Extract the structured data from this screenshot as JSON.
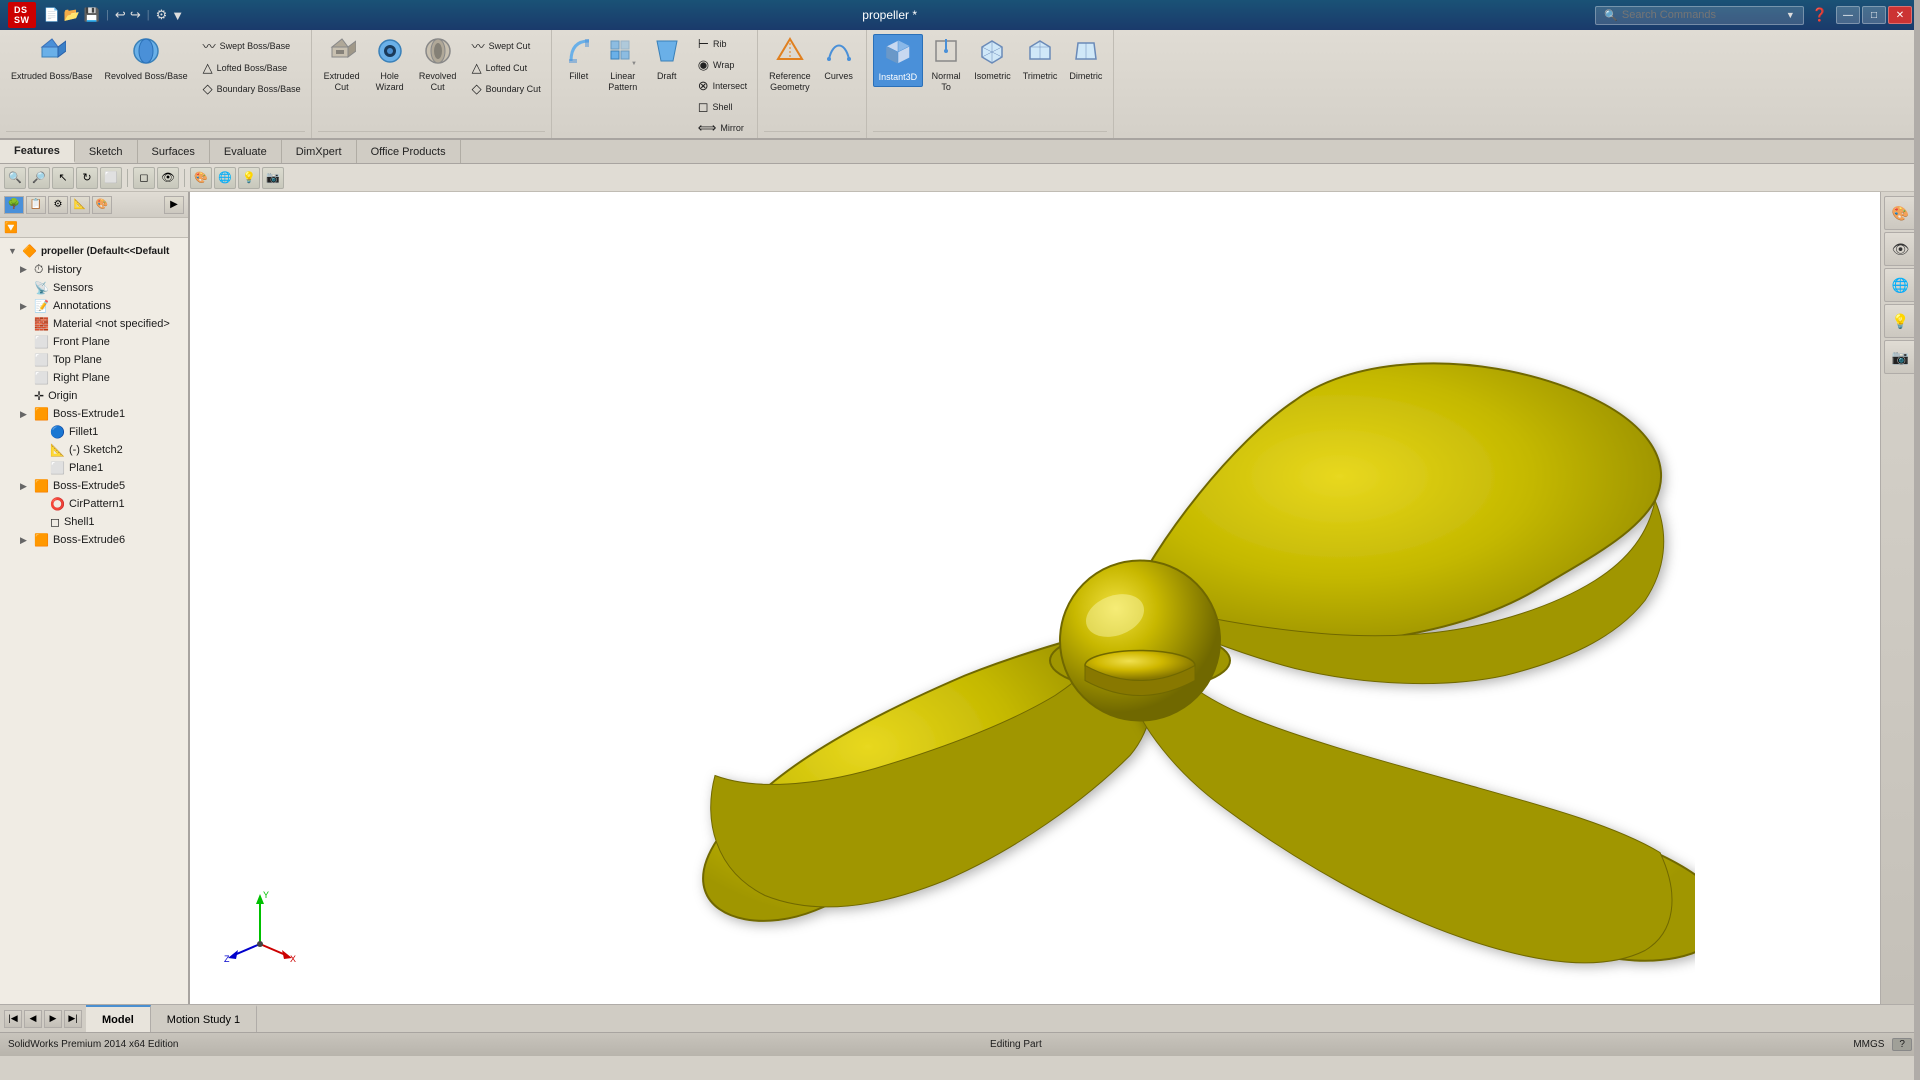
{
  "app": {
    "title": "propeller *",
    "software": "SOLIDWORKS",
    "logo_text": "DS SOLIDWORKS"
  },
  "titlebar": {
    "title": "propeller *",
    "win_controls": [
      "—",
      "□",
      "✕"
    ],
    "search_placeholder": "Search Commands"
  },
  "quick_access": {
    "buttons": [
      "📄",
      "📁",
      "💾",
      "↩",
      "↪",
      "⚙"
    ]
  },
  "ribbon": {
    "groups": [
      {
        "name": "boss-base",
        "items_large": [
          {
            "id": "extruded-boss",
            "icon": "⬜",
            "label": "Extruded\nBoss/Base"
          },
          {
            "id": "revolved-boss",
            "icon": "⭕",
            "label": "Revolved\nBoss/Base"
          }
        ],
        "items_small": [
          {
            "id": "swept-boss",
            "icon": "〰",
            "label": "Swept Boss/Base"
          },
          {
            "id": "lofted-boss",
            "icon": "△",
            "label": "Lofted Boss/Base"
          },
          {
            "id": "boundary-boss",
            "icon": "◇",
            "label": "Boundary Boss/Base"
          }
        ]
      },
      {
        "name": "cut",
        "items_large": [
          {
            "id": "extruded-cut",
            "icon": "⬛",
            "label": "Extruded\nCut"
          },
          {
            "id": "hole-wizard",
            "icon": "🔵",
            "label": "Hole\nWizard"
          },
          {
            "id": "revolved-cut",
            "icon": "⭕",
            "label": "Revolved\nCut"
          }
        ],
        "items_small": [
          {
            "id": "swept-cut",
            "icon": "〰",
            "label": "Swept Cut"
          },
          {
            "id": "lofted-cut",
            "icon": "△",
            "label": "Lofted Cut"
          },
          {
            "id": "boundary-cut",
            "icon": "◇",
            "label": "Boundary Cut"
          }
        ]
      },
      {
        "name": "features",
        "items_large": [
          {
            "id": "fillet",
            "icon": "⌒",
            "label": "Fillet"
          },
          {
            "id": "linear-pattern",
            "icon": "⊞",
            "label": "Linear\nPattern"
          },
          {
            "id": "draft",
            "icon": "◺",
            "label": "Draft"
          }
        ],
        "items_small": [
          {
            "id": "rib",
            "icon": "⟋",
            "label": "Rib"
          },
          {
            "id": "wrap",
            "icon": "◉",
            "label": "Wrap"
          },
          {
            "id": "intersect",
            "icon": "⊗",
            "label": "Intersect"
          },
          {
            "id": "shell",
            "icon": "◻",
            "label": "Shell"
          },
          {
            "id": "mirror",
            "icon": "⟺",
            "label": "Mirror"
          }
        ]
      },
      {
        "name": "reference-geometry",
        "items_large": [
          {
            "id": "reference-geometry",
            "icon": "△",
            "label": "Reference\nGeometry"
          },
          {
            "id": "curves",
            "icon": "〜",
            "label": "Curves"
          }
        ]
      },
      {
        "name": "views",
        "items_large": [
          {
            "id": "instant3d",
            "icon": "⬡",
            "label": "Instant3D",
            "active": true
          },
          {
            "id": "normal-to",
            "icon": "⊥",
            "label": "Normal\nTo"
          },
          {
            "id": "isometric",
            "icon": "◫",
            "label": "Isometric"
          },
          {
            "id": "trimetric",
            "icon": "◪",
            "label": "Trimetric"
          },
          {
            "id": "dimetric",
            "icon": "◩",
            "label": "Dimetric"
          }
        ]
      }
    ]
  },
  "tabs": {
    "items": [
      "Features",
      "Sketch",
      "Surfaces",
      "Evaluate",
      "DimXpert",
      "Office Products"
    ],
    "active": "Features"
  },
  "feature_tree": {
    "root": "propeller  (Default<<Default",
    "items": [
      {
        "id": "history",
        "label": "History",
        "icon": "⏱",
        "expandable": true,
        "level": 0
      },
      {
        "id": "sensors",
        "label": "Sensors",
        "icon": "📡",
        "expandable": false,
        "level": 1
      },
      {
        "id": "annotations",
        "label": "Annotations",
        "icon": "📝",
        "expandable": true,
        "level": 0
      },
      {
        "id": "material",
        "label": "Material <not specified>",
        "icon": "🧱",
        "expandable": false,
        "level": 1
      },
      {
        "id": "front-plane",
        "label": "Front Plane",
        "icon": "⬜",
        "expandable": false,
        "level": 1
      },
      {
        "id": "top-plane",
        "label": "Top Plane",
        "icon": "⬜",
        "expandable": false,
        "level": 1
      },
      {
        "id": "right-plane",
        "label": "Right Plane",
        "icon": "⬜",
        "expandable": false,
        "level": 1
      },
      {
        "id": "origin",
        "label": "Origin",
        "icon": "✛",
        "expandable": false,
        "level": 1
      },
      {
        "id": "boss-extrude1",
        "label": "Boss-Extrude1",
        "icon": "🟧",
        "expandable": true,
        "level": 0
      },
      {
        "id": "fillet1",
        "label": "Fillet1",
        "icon": "🔵",
        "expandable": false,
        "level": 1
      },
      {
        "id": "sketch2",
        "label": "(-) Sketch2",
        "icon": "📐",
        "expandable": false,
        "level": 1
      },
      {
        "id": "plane1",
        "label": "Plane1",
        "icon": "⬜",
        "expandable": false,
        "level": 1
      },
      {
        "id": "boss-extrude5",
        "label": "Boss-Extrude5",
        "icon": "🟧",
        "expandable": true,
        "level": 0
      },
      {
        "id": "cirpattern1",
        "label": "CirPattern1",
        "icon": "⭕",
        "expandable": false,
        "level": 1
      },
      {
        "id": "shell1",
        "label": "Shell1",
        "icon": "◻",
        "expandable": false,
        "level": 1
      },
      {
        "id": "boss-extrude6",
        "label": "Boss-Extrude6",
        "icon": "🟧",
        "expandable": true,
        "level": 0
      }
    ]
  },
  "viewport": {
    "background_color": "#ffffff",
    "model_color": "#d4c810"
  },
  "right_panel": {
    "buttons": [
      {
        "id": "appearance",
        "icon": "🎨"
      },
      {
        "id": "display-state",
        "icon": "👁"
      },
      {
        "id": "scene",
        "icon": "🌐"
      },
      {
        "id": "lights",
        "icon": "💡"
      },
      {
        "id": "cameras",
        "icon": "📷"
      }
    ]
  },
  "bottom_tabs": {
    "items": [
      "Model",
      "Motion Study 1"
    ],
    "active": "Model"
  },
  "status_bar": {
    "left": "SolidWorks Premium 2014 x64 Edition",
    "middle": "Editing Part",
    "right": "MMGS",
    "help": "?"
  },
  "view_toolbar": {
    "buttons": [
      "🔍",
      "🔎",
      "👆",
      "📐",
      "⬜",
      "◻",
      "🔘",
      "🎨",
      "🖼",
      "📷"
    ]
  }
}
